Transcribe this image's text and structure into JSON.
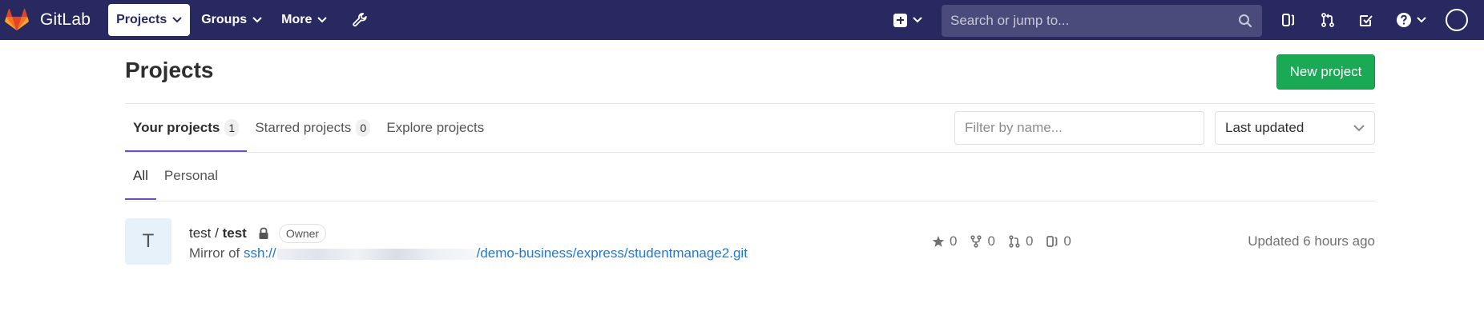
{
  "navbar": {
    "brand": "GitLab",
    "menu": [
      {
        "label": "Projects",
        "active": true
      },
      {
        "label": "Groups",
        "active": false
      },
      {
        "label": "More",
        "active": false
      }
    ],
    "search_placeholder": "Search or jump to...",
    "icons": [
      "plus-square-icon",
      "issues-icon",
      "merge-request-icon",
      "todo-icon",
      "help-icon",
      "user-avatar"
    ]
  },
  "page": {
    "title": "Projects",
    "new_project_label": "New project",
    "tabs": [
      {
        "label": "Your projects",
        "count": "1",
        "active": true
      },
      {
        "label": "Starred projects",
        "count": "0",
        "active": false
      },
      {
        "label": "Explore projects",
        "active": false
      }
    ],
    "filter_placeholder": "Filter by name...",
    "sort_value": "Last updated",
    "subtabs": [
      {
        "label": "All",
        "active": true
      },
      {
        "label": "Personal",
        "active": false
      }
    ]
  },
  "project": {
    "avatar_letter": "T",
    "namespace": "test",
    "separator": " / ",
    "name": "test",
    "role": "Owner",
    "mirror_prefix": "Mirror of ",
    "url_start": "ssh://",
    "url_end": "/demo-business/express/studentmanage2.git",
    "stars": "0",
    "forks": "0",
    "merge_requests": "0",
    "issues": "0",
    "updated": "Updated 6 hours ago"
  },
  "colors": {
    "navbar": "#292961",
    "accent": "#6b4fbb",
    "new_project": "#1aaa55",
    "link": "#1f78d1",
    "logo": "#fc6d26"
  }
}
